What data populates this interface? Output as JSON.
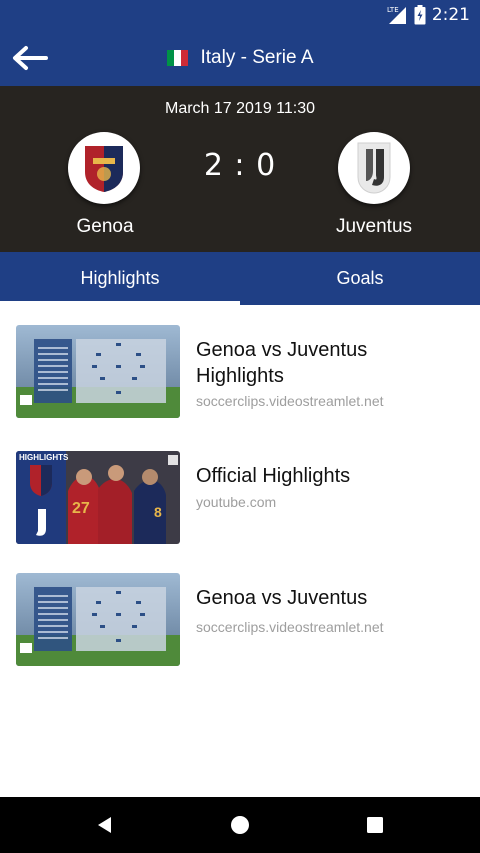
{
  "status_bar": {
    "network": "LTE",
    "time": "2:21"
  },
  "app_bar": {
    "title": "Italy - Serie A",
    "flag_colors": [
      "#009246",
      "#ffffff",
      "#ce2b37"
    ]
  },
  "match": {
    "date": "March 17 2019 11:30",
    "home_team": "Genoa",
    "away_team": "Juventus",
    "score": "2 : 0"
  },
  "tabs": [
    {
      "label": "Highlights",
      "active": true
    },
    {
      "label": "Goals",
      "active": false
    }
  ],
  "videos": [
    {
      "title": "Genoa vs Juventus Highlights",
      "source": "soccerclips.videostreamlet.net",
      "thumb": "lineup-graphic"
    },
    {
      "title": "Official Highlights",
      "source": "youtube.com",
      "thumb": "highlights-photo",
      "thumb_label": "HIGHLIGHTS"
    },
    {
      "title": "Genoa vs Juventus",
      "source": "soccerclips.videostreamlet.net",
      "thumb": "lineup-graphic"
    }
  ],
  "colors": {
    "primary": "#1f3f85",
    "header_dark": "#272420"
  }
}
